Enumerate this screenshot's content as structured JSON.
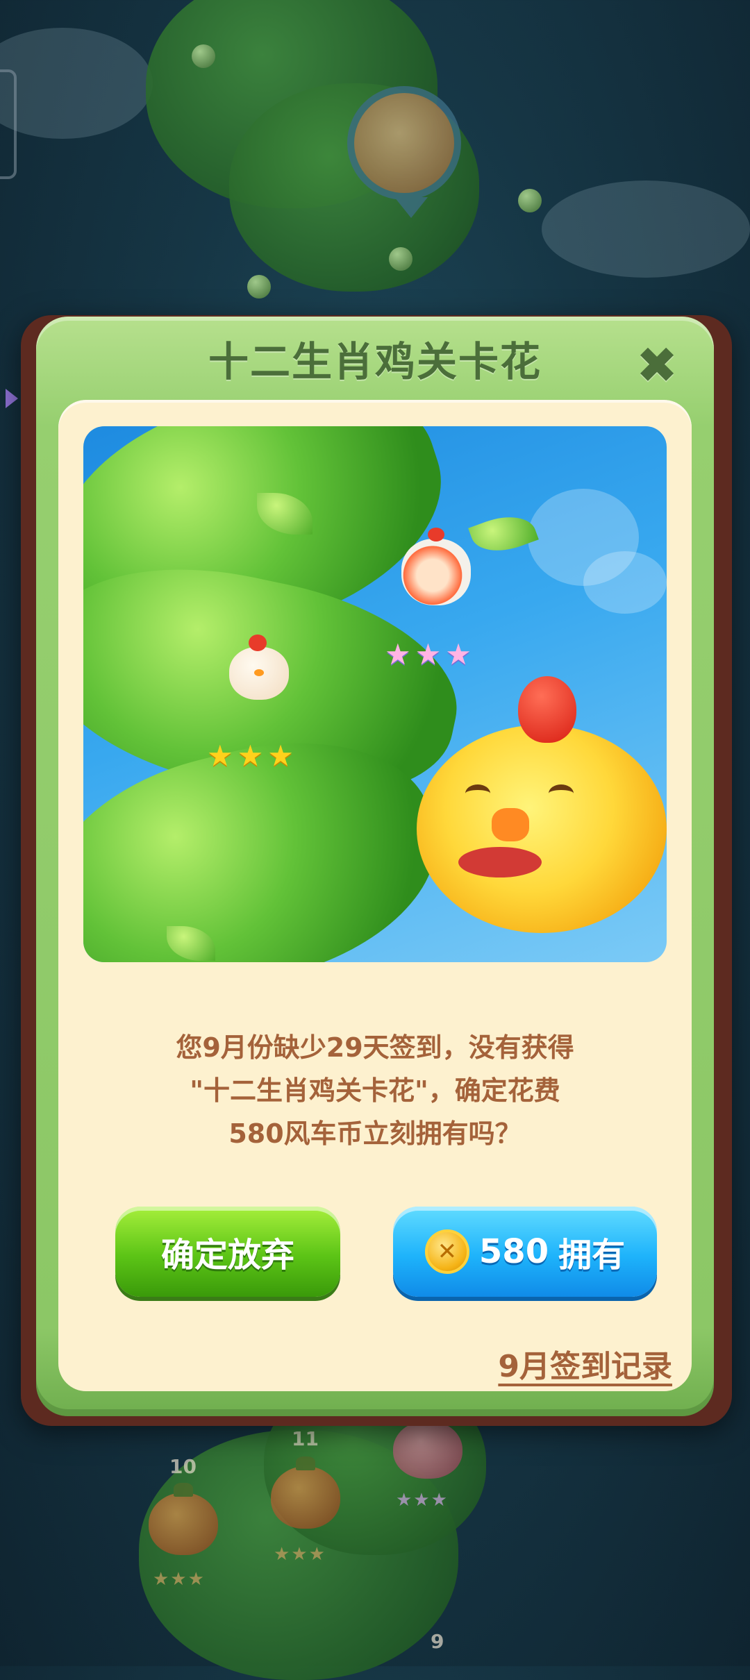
{
  "dialog": {
    "title": "十二生肖鸡关卡花",
    "close_icon": "close-icon",
    "message_lines": [
      "您9月份缺少29天签到，没有获得",
      "\"十二生肖鸡关卡花\"，确定花费",
      "580风车币立刻拥有吗？"
    ],
    "cancel_label": "确定放弃",
    "buy_amount": "580",
    "buy_label": "拥有",
    "coin_icon": "coin-icon",
    "record_link": "9月签到记录"
  },
  "artwork": {
    "stars_left": "★★★",
    "stars_right": "★★★"
  },
  "background_map": {
    "levels": [
      {
        "num": "10",
        "stars": "★★★"
      },
      {
        "num": "11",
        "stars": "★★★"
      },
      {
        "num": "9",
        "stars": ""
      }
    ],
    "top_right_stars": "★★★"
  },
  "colors": {
    "title_green": "#4b6e3a",
    "message_brown": "#a4623a",
    "cancel_button": "#5cc416",
    "buy_button": "#1eb3fb"
  }
}
